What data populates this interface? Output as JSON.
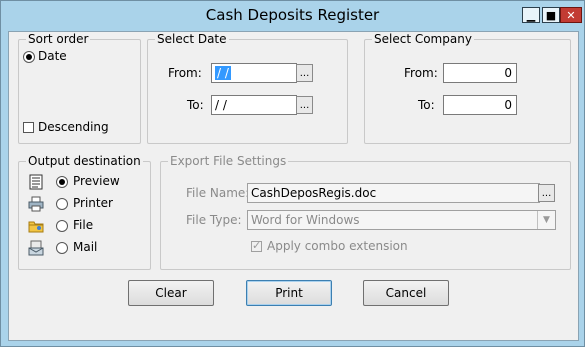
{
  "window": {
    "title": "Cash Deposits Register",
    "controls": {
      "minimize": "▁",
      "maximize": "■",
      "close": "✕"
    }
  },
  "sort_order": {
    "legend": "Sort order",
    "date_label": "Date",
    "date_selected": true,
    "descending_label": "Descending",
    "descending_checked": false
  },
  "select_date": {
    "legend": "Select Date",
    "from_label": "From:",
    "from_value": "/ /",
    "to_label": "To:",
    "to_value": "/ /",
    "ellipsis": "..."
  },
  "select_company": {
    "legend": "Select Company",
    "from_label": "From:",
    "from_value": "0",
    "to_label": "To:",
    "to_value": "0"
  },
  "output": {
    "legend": "Output destination",
    "options": [
      {
        "label": "Preview",
        "icon": "preview-icon",
        "selected": true
      },
      {
        "label": "Printer",
        "icon": "printer-icon",
        "selected": false
      },
      {
        "label": "File",
        "icon": "folder-icon",
        "selected": false
      },
      {
        "label": "Mail",
        "icon": "mail-icon",
        "selected": false
      }
    ]
  },
  "export": {
    "legend": "Export  File Settings",
    "file_name_label": "File Name:",
    "file_name_value": "CashDeposRegis.doc",
    "file_type_label": "File Type:",
    "file_type_value": "Word for Windows",
    "apply_label": "Apply combo extension",
    "apply_checked": true,
    "ellipsis": "..."
  },
  "buttons": {
    "clear": "Clear",
    "print": "Print",
    "cancel": "Cancel"
  },
  "colors": {
    "frame": "#aad3ea",
    "selection": "#3399ff",
    "close": "#c23b33"
  }
}
